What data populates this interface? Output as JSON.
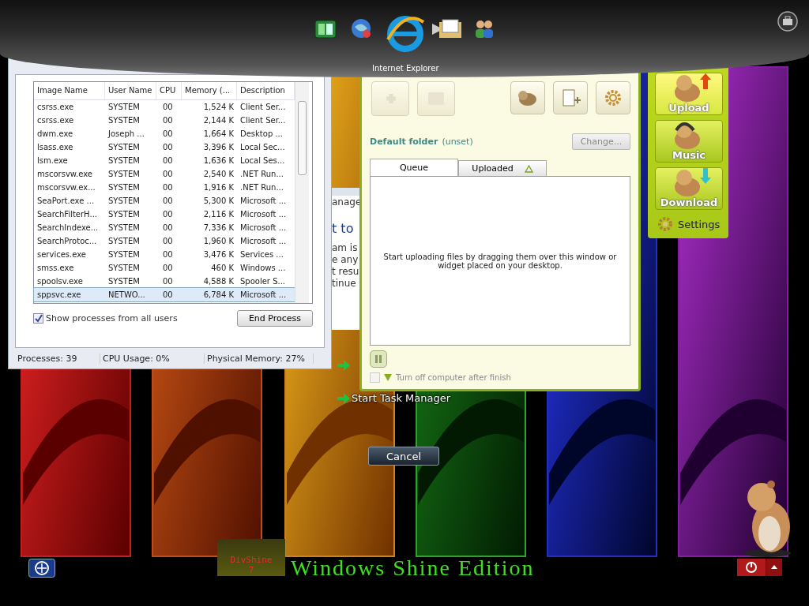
{
  "dock": {
    "hover_label": "Internet Explorer"
  },
  "task_manager": {
    "columns": [
      "Image Name",
      "User Name",
      "CPU",
      "Memory (...",
      "Description"
    ],
    "rows": [
      {
        "cells": [
          "csrss.exe",
          "SYSTEM",
          "00",
          "1,524 K",
          "Client Ser..."
        ],
        "selected": false
      },
      {
        "cells": [
          "csrss.exe",
          "SYSTEM",
          "00",
          "2,144 K",
          "Client Ser..."
        ],
        "selected": false
      },
      {
        "cells": [
          "dwm.exe",
          "Joseph ...",
          "00",
          "1,664 K",
          "Desktop ..."
        ],
        "selected": false
      },
      {
        "cells": [
          "lsass.exe",
          "SYSTEM",
          "00",
          "3,396 K",
          "Local Sec..."
        ],
        "selected": false
      },
      {
        "cells": [
          "lsm.exe",
          "SYSTEM",
          "00",
          "1,636 K",
          "Local Ses..."
        ],
        "selected": false
      },
      {
        "cells": [
          "mscorsvw.exe",
          "SYSTEM",
          "00",
          "2,540 K",
          ".NET Run..."
        ],
        "selected": false
      },
      {
        "cells": [
          "mscorsvw.ex...",
          "SYSTEM",
          "00",
          "1,916 K",
          ".NET Run..."
        ],
        "selected": false
      },
      {
        "cells": [
          "SeaPort.exe ...",
          "SYSTEM",
          "00",
          "5,300 K",
          "Microsoft ..."
        ],
        "selected": false
      },
      {
        "cells": [
          "SearchFilterH...",
          "SYSTEM",
          "00",
          "2,116 K",
          "Microsoft ..."
        ],
        "selected": false
      },
      {
        "cells": [
          "SearchIndexe...",
          "SYSTEM",
          "00",
          "7,336 K",
          "Microsoft ..."
        ],
        "selected": false
      },
      {
        "cells": [
          "SearchProtoc...",
          "SYSTEM",
          "00",
          "1,960 K",
          "Microsoft ..."
        ],
        "selected": false
      },
      {
        "cells": [
          "services.exe",
          "SYSTEM",
          "00",
          "3,476 K",
          "Services ..."
        ],
        "selected": false
      },
      {
        "cells": [
          "smss.exe",
          "SYSTEM",
          "00",
          "460 K",
          "Windows ..."
        ],
        "selected": false
      },
      {
        "cells": [
          "spoolsv.exe",
          "SYSTEM",
          "00",
          "4,588 K",
          "Spooler S..."
        ],
        "selected": false
      },
      {
        "cells": [
          "sppsvc.exe",
          "NETWO...",
          "00",
          "6,784 K",
          "Microsoft ..."
        ],
        "selected": true
      }
    ],
    "show_all_users": {
      "label": "Show processes from all users",
      "checked": true
    },
    "end_process": "End Process",
    "status": [
      "Processes: 39",
      "CPU Usage: 0%",
      "Physical Memory: 27%"
    ]
  },
  "background_window": {
    "fragments": [
      "anage",
      "t to",
      "am is",
      "e any",
      "t resu",
      "tinue"
    ]
  },
  "uploader": {
    "default_folder": {
      "label": "Default folder",
      "value": "(unset)"
    },
    "change_button": "Change...",
    "tabs": [
      {
        "label": "Queue",
        "selected": true
      },
      {
        "label": "Uploaded",
        "selected": false
      }
    ],
    "empty_message": "Start uploading files by dragging them over this window or widget placed on your desktop.",
    "shutdown": {
      "label": "Turn off computer after finish",
      "checked": false
    }
  },
  "side_panel": {
    "buttons": [
      {
        "label": "Upload",
        "kind": "upload"
      },
      {
        "label": "Music",
        "kind": "music"
      },
      {
        "label": "Download",
        "kind": "download"
      }
    ],
    "settings": "Settings"
  },
  "security_screen": {
    "option": "Start Task Manager",
    "cancel": "Cancel",
    "logo": [
      "DivShine",
      "7"
    ],
    "edition": "Windows Shine Edition"
  }
}
